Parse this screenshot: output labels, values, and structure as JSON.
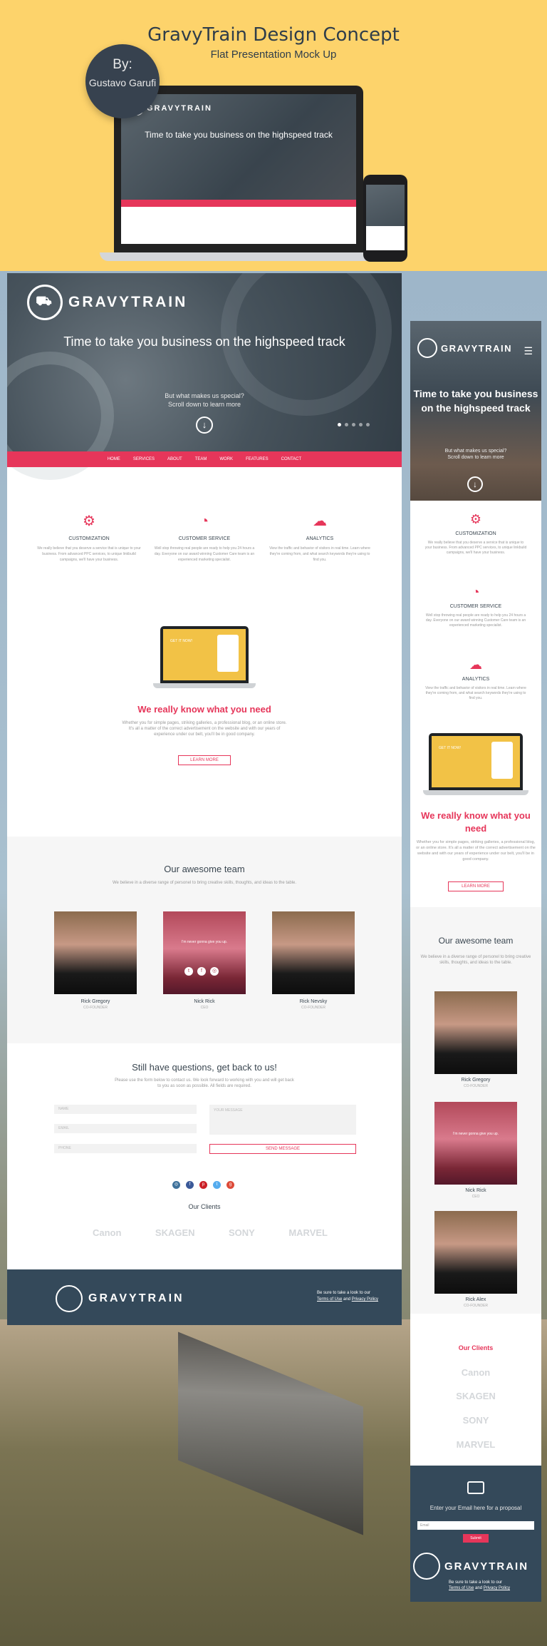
{
  "banner": {
    "title": "GravyTrain Design Concept",
    "subtitle": "Flat Presentation Mock Up",
    "author_by": "By:",
    "author_name": "Gustavo Garufi"
  },
  "brand": {
    "logo_text": "GRAVYTRAIN"
  },
  "hero": {
    "headline": "Time to take you business on the highspeed track",
    "sub_line1": "But what makes us special?",
    "sub_line2": "Scroll down to learn more"
  },
  "nav": [
    "HOME",
    "SERVICES",
    "ABOUT",
    "TEAM",
    "WORK",
    "FEATURES",
    "CONTACT"
  ],
  "features": [
    {
      "icon": "gear-icon",
      "title": "CUSTOMIZATION",
      "text": "We really believe that you deserve a service that is unique to your business. From advanced PPC services, to unique linkbuild campaigns, we'll have your business."
    },
    {
      "icon": "clock-icon",
      "title": "CUSTOMER SERVICE",
      "text": "Well stop throwing real people are ready to help you 24 hours a day. Everyone on our award winning Customer Care team is an experienced marketing specialist."
    },
    {
      "icon": "cloud-upload-icon",
      "title": "ANALYTICS",
      "text": "View the traffic and behavior of visitors in real time. Learn where they're coming from, and what search keywords they're using to find you."
    }
  ],
  "know": {
    "title": "We really know what you need",
    "text": "Whether you for simple pages, striking galleries, a professional blog, or an online store. It's all a matter of the correct advertisement on the website and with our years of experience under our belt, you'll be in good company.",
    "button": "LEARN MORE",
    "screen_text": "GET IT NOW!"
  },
  "team": {
    "title": "Our awesome team",
    "subtitle": "We believe in a diverse range of personel to bring creative skills, thoughts, and ideas to the table.",
    "members": [
      {
        "name": "Rick Gregory",
        "role": "CO-FOUNDER"
      },
      {
        "name": "Nick Rick",
        "role": "CEO"
      },
      {
        "name": "Rick Nevsky",
        "role": "CO-FOUNDER"
      }
    ],
    "mobile_members": [
      {
        "name": "Rick Gregory",
        "role": "CO-FOUNDER"
      },
      {
        "name": "Nick Rick",
        "role": "CEO"
      },
      {
        "name": "Rick Alex",
        "role": "CO-FOUNDER"
      }
    ],
    "hover_quote": "I'm never gonna give you up."
  },
  "contact": {
    "title": "Still have questions, get back to us!",
    "subtitle": "Please use the form below to contact us. We look forward to working with you and will get back to you as soon as possible. All fields are required.",
    "name_placeholder": "NAME",
    "email_placeholder": "EMAIL",
    "phone_placeholder": "PHONE",
    "message_placeholder": "YOUR MESSAGE",
    "send_button": "SEND MESSAGE"
  },
  "social": [
    {
      "icon": "instagram-icon",
      "glyph": "◎",
      "color": "#3f729b"
    },
    {
      "icon": "facebook-icon",
      "glyph": "f",
      "color": "#3b5998"
    },
    {
      "icon": "pinterest-icon",
      "glyph": "p",
      "color": "#cb2027"
    },
    {
      "icon": "twitter-icon",
      "glyph": "t",
      "color": "#55acee"
    },
    {
      "icon": "google-plus-icon",
      "glyph": "g",
      "color": "#dd4b39"
    }
  ],
  "clients": {
    "title": "Our Clients",
    "logos": [
      "Canon",
      "SKAGEN",
      "SONY",
      "MARVEL"
    ]
  },
  "footer": {
    "legal_prefix": "Be sure to take a look to our",
    "terms": "Terms of Use",
    "and": "and",
    "privacy": "Privacy Policy"
  },
  "newsletter": {
    "prompt": "Enter your Email here for a proposal",
    "email_placeholder": "Email",
    "submit": "Submit"
  },
  "colors": {
    "accent": "#e6365a",
    "dark": "#34495a",
    "banner": "#fdd36b"
  }
}
